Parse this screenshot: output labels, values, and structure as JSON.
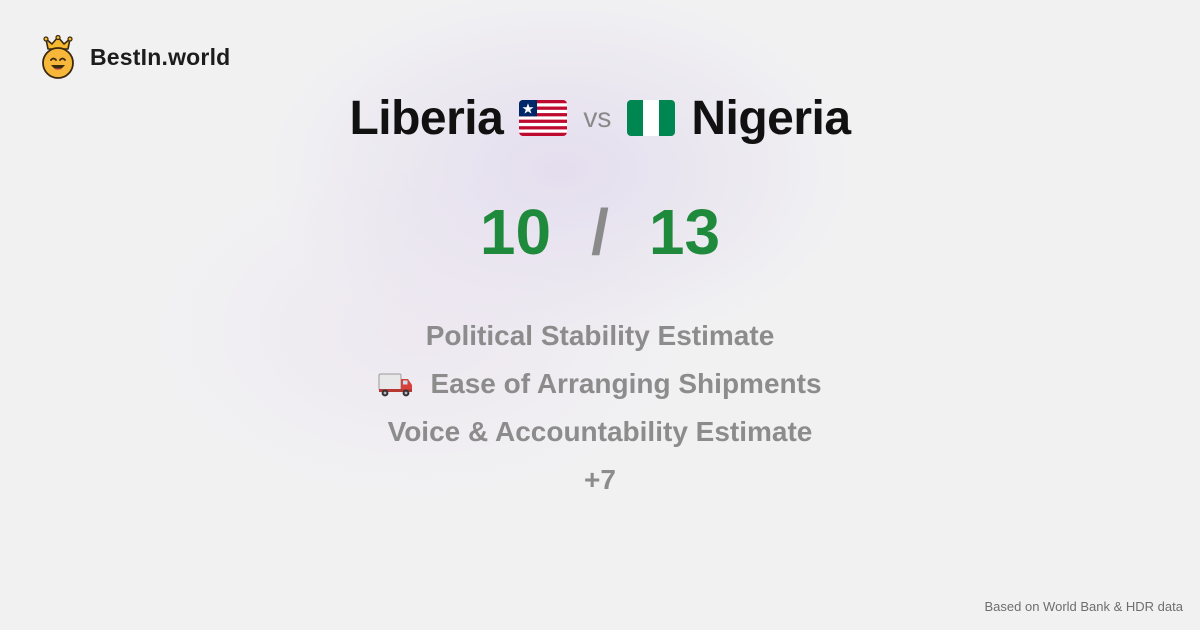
{
  "brand": {
    "name": "BestIn.world",
    "logo_icon": "crowned-smiley-icon"
  },
  "comparison": {
    "left_country": "Liberia",
    "left_flag_icon": "liberia-flag-icon",
    "vs_label": "vs",
    "right_country": "Nigeria",
    "right_flag_icon": "nigeria-flag-icon"
  },
  "scores": {
    "left": "10",
    "separator": "/",
    "right": "13",
    "color": "#1f8a3b"
  },
  "metrics": {
    "items": [
      {
        "label": "Political Stability Estimate",
        "icon": ""
      },
      {
        "label": "Ease of Arranging Shipments",
        "icon": "delivery-truck-icon"
      },
      {
        "label": "Voice & Accountability Estimate",
        "icon": ""
      }
    ],
    "more_label": "+7"
  },
  "footer": {
    "source_note": "Based on World Bank & HDR data"
  }
}
